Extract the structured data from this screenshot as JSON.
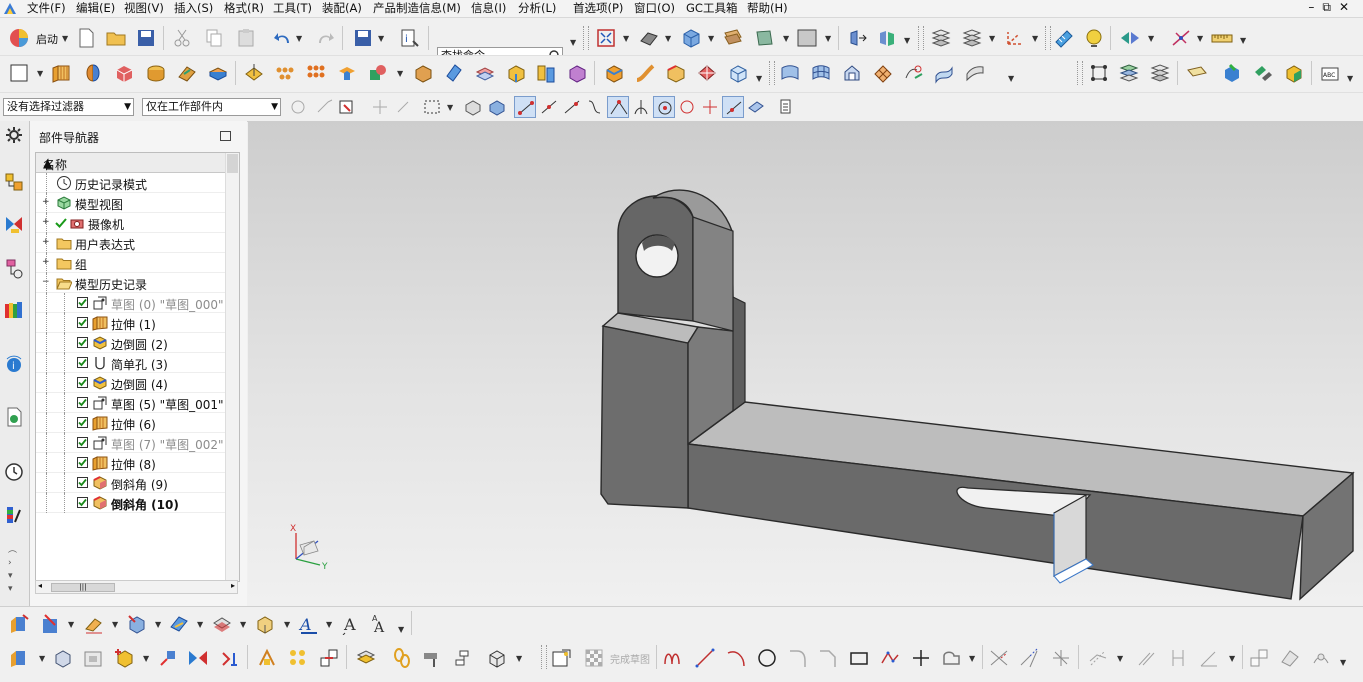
{
  "menu": [
    "文件(F)",
    "编辑(E)",
    "视图(V)",
    "插入(S)",
    "格式(R)",
    "工具(T)",
    "装配(A)",
    "产品制造信息(M)",
    "信息(I)",
    "分析(L)",
    "首选项(P)",
    "窗口(O)",
    "GC工具箱",
    "帮助(H)"
  ],
  "toolbar": {
    "start_label": "启动",
    "search_value": "查找命令"
  },
  "selection": {
    "filter_value": "没有选择过滤器",
    "scope_value": "仅在工作部件内"
  },
  "navigator": {
    "title": "部件导航器",
    "column_header": "名称",
    "top_items": [
      {
        "label": "历史记录模式",
        "icon": "clock-icon"
      },
      {
        "label": "模型视图",
        "icon": "model-view-icon"
      },
      {
        "label": "摄像机",
        "icon": "camera-icon"
      },
      {
        "label": "用户表达式",
        "icon": "folder-icon"
      },
      {
        "label": "组",
        "icon": "folder-icon"
      },
      {
        "label": "模型历史记录",
        "icon": "folder-open-icon"
      }
    ],
    "features": [
      {
        "label": "草图 (0) \"草图_000\"",
        "icon": "sketch-icon",
        "dim": true
      },
      {
        "label": "拉伸 (1)",
        "icon": "extrude-icon"
      },
      {
        "label": "边倒圆 (2)",
        "icon": "edge-blend-icon"
      },
      {
        "label": "简单孔 (3)",
        "icon": "hole-icon"
      },
      {
        "label": "边倒圆 (4)",
        "icon": "edge-blend-icon"
      },
      {
        "label": "草图 (5) \"草图_001\"",
        "icon": "sketch-icon"
      },
      {
        "label": "拉伸 (6)",
        "icon": "extrude-icon"
      },
      {
        "label": "草图 (7) \"草图_002\"",
        "icon": "sketch-icon",
        "dim": true
      },
      {
        "label": "拉伸 (8)",
        "icon": "extrude-icon"
      },
      {
        "label": "倒斜角 (9)",
        "icon": "chamfer-icon"
      },
      {
        "label": "倒斜角 (10)",
        "icon": "chamfer-icon",
        "bold": true
      }
    ]
  },
  "sketch_toolbar": {
    "finish_sketch_label": "完成草图"
  },
  "triad": {
    "x": "X",
    "y": "Y"
  },
  "colors": {
    "accent_blue": "#3c78c8",
    "check_green": "#2a9a2a",
    "model_face": "#6b6b6b"
  }
}
